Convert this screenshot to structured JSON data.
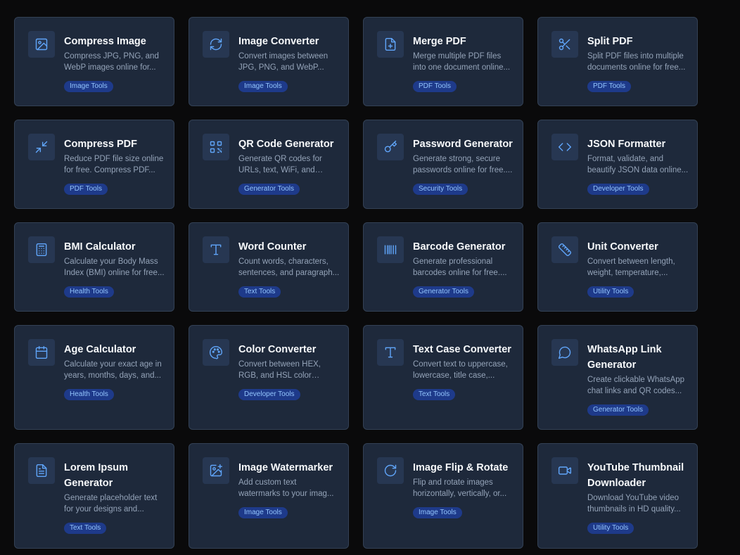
{
  "tools": [
    {
      "title": "Compress Image",
      "desc": "Compress JPG, PNG, and WebP images online for...",
      "badge": "Image Tools",
      "icon": "image-icon"
    },
    {
      "title": "Image Converter",
      "desc": "Convert images between JPG, PNG, and WebP...",
      "badge": "Image Tools",
      "icon": "refresh-icon"
    },
    {
      "title": "Merge PDF",
      "desc": "Merge multiple PDF files into one document online...",
      "badge": "PDF Tools",
      "icon": "file-plus-icon"
    },
    {
      "title": "Split PDF",
      "desc": "Split PDF files into multiple documents online for free...",
      "badge": "PDF Tools",
      "icon": "scissors-icon"
    },
    {
      "title": "Compress PDF",
      "desc": "Reduce PDF file size online for free. Compress PDF...",
      "badge": "PDF Tools",
      "icon": "minimize-icon"
    },
    {
      "title": "QR Code Generator",
      "desc": "Generate QR codes for URLs, text, WiFi, and more...",
      "badge": "Generator Tools",
      "icon": "qr-code-icon"
    },
    {
      "title": "Password Generator",
      "desc": "Generate strong, secure passwords online for free....",
      "badge": "Security Tools",
      "icon": "key-icon"
    },
    {
      "title": "JSON Formatter",
      "desc": "Format, validate, and beautify JSON data online...",
      "badge": "Developer Tools",
      "icon": "code-icon"
    },
    {
      "title": "BMI Calculator",
      "desc": "Calculate your Body Mass Index (BMI) online for free...",
      "badge": "Health Tools",
      "icon": "calculator-icon"
    },
    {
      "title": "Word Counter",
      "desc": "Count words, characters, sentences, and paragraph...",
      "badge": "Text Tools",
      "icon": "type-icon"
    },
    {
      "title": "Barcode Generator",
      "desc": "Generate professional barcodes online for free....",
      "badge": "Generator Tools",
      "icon": "barcode-icon"
    },
    {
      "title": "Unit Converter",
      "desc": "Convert between length, weight, temperature,...",
      "badge": "Utility Tools",
      "icon": "ruler-icon"
    },
    {
      "title": "Age Calculator",
      "desc": "Calculate your exact age in years, months, days, and...",
      "badge": "Health Tools",
      "icon": "calendar-icon"
    },
    {
      "title": "Color Converter",
      "desc": "Convert between HEX, RGB, and HSL color formats wit...",
      "badge": "Developer Tools",
      "icon": "palette-icon"
    },
    {
      "title": "Text Case Converter",
      "desc": "Convert text to uppercase, lowercase, title case,...",
      "badge": "Text Tools",
      "icon": "type-icon"
    },
    {
      "title": "WhatsApp Link Generator",
      "desc": "Create clickable WhatsApp chat links and QR codes...",
      "badge": "Generator Tools",
      "icon": "chat-bubble-icon"
    },
    {
      "title": "Lorem Ipsum Generator",
      "desc": "Generate placeholder text for your designs and...",
      "badge": "Text Tools",
      "icon": "document-text-icon"
    },
    {
      "title": "Image Watermarker",
      "desc": "Add custom text watermarks to your imag...",
      "badge": "Image Tools",
      "icon": "image-plus-icon"
    },
    {
      "title": "Image Flip & Rotate",
      "desc": "Flip and rotate images horizontally, vertically, or...",
      "badge": "Image Tools",
      "icon": "rotate-icon"
    },
    {
      "title": "YouTube Thumbnail Downloader",
      "desc": "Download YouTube video thumbnails in HD quality...",
      "badge": "Utility Tools",
      "icon": "video-icon"
    }
  ]
}
